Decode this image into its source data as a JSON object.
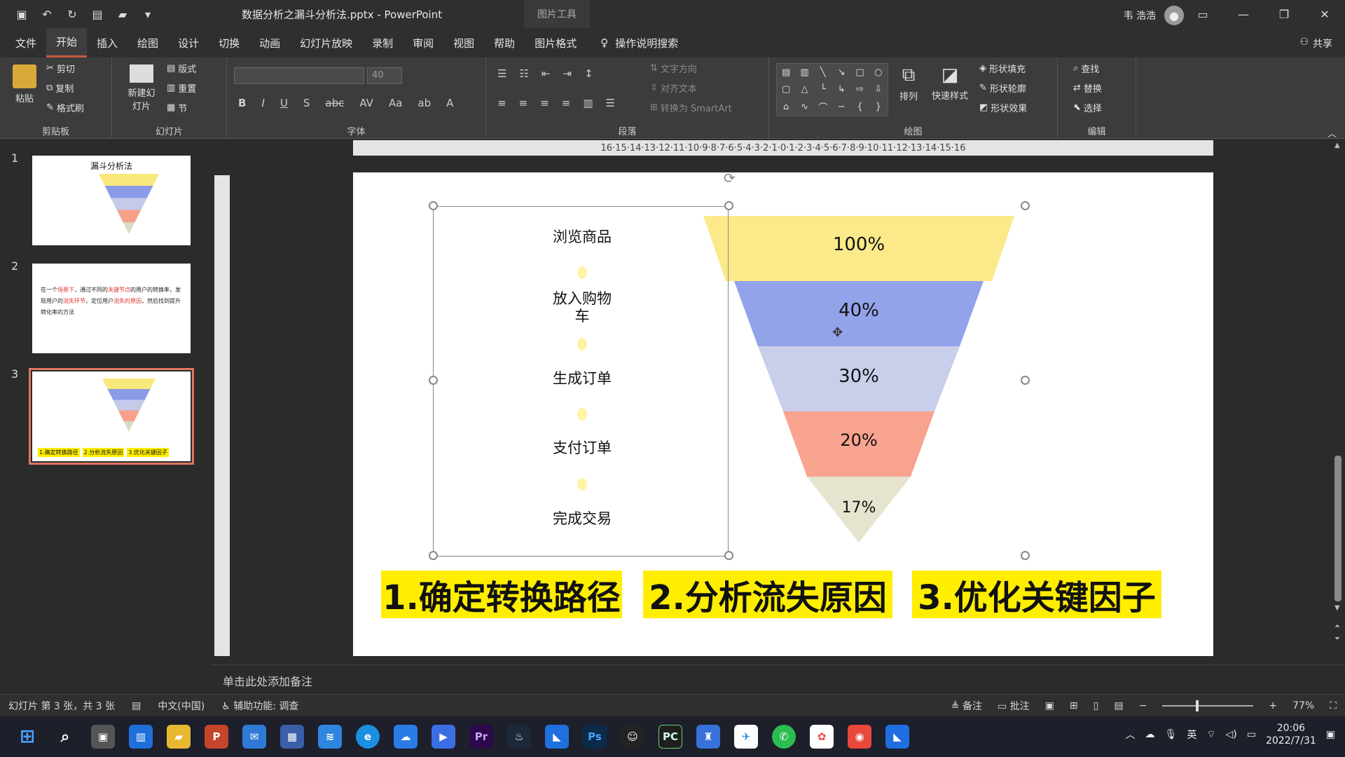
{
  "titlebar": {
    "doc_title": "数据分析之漏斗分析法.pptx - PowerPoint",
    "contextual_tab": "图片工具",
    "user_name": "韦 浩浩"
  },
  "menu": {
    "tabs": [
      "文件",
      "开始",
      "插入",
      "绘图",
      "设计",
      "切换",
      "动画",
      "幻灯片放映",
      "录制",
      "审阅",
      "视图",
      "帮助",
      "图片格式"
    ],
    "active_tab": "开始",
    "search_label": "操作说明搜索",
    "share_label": "共享"
  },
  "ribbon": {
    "clipboard": {
      "paste": "粘贴",
      "cut": "剪切",
      "copy": "复制",
      "format_painter": "格式刷",
      "label": "剪贴板"
    },
    "slides": {
      "new_slide": "新建幻灯片",
      "layout": "版式",
      "reset": "重置",
      "section": "节",
      "label": "幻灯片"
    },
    "font": {
      "size": "40",
      "label": "字体"
    },
    "paragraph": {
      "text_direction": "文字方向",
      "align_text": "对齐文本",
      "smartart": "转换为 SmartArt",
      "label": "段落"
    },
    "drawing": {
      "arrange": "排列",
      "quick_styles": "快速样式",
      "shape_fill": "形状填充",
      "shape_outline": "形状轮廓",
      "shape_effects": "形状效果",
      "label": "绘图"
    },
    "editing": {
      "find": "查找",
      "replace": "替换",
      "select": "选择",
      "label": "编辑"
    }
  },
  "thumbnails": {
    "slide1_title": "漏斗分析法",
    "slide2_text_parts": [
      "在一个",
      "场景下",
      "，通过不同的",
      "关键节点",
      "的用户的转换率，发现用户的",
      "流失环节",
      "，定位用户",
      "流失的原因",
      "，然后找到提升转化率的方法"
    ],
    "slide3_bars": [
      "1.确定转换路径",
      "2.分析流失原因",
      "3.优化关键因子"
    ],
    "numbers": [
      "1",
      "2",
      "3"
    ]
  },
  "slide": {
    "steps": [
      "浏览商品",
      "放入购物\n车",
      "生成订单",
      "支付订单",
      "完成交易"
    ],
    "percentages": [
      "100%",
      "40%",
      "30%",
      "20%",
      "17%"
    ],
    "banners": [
      "1.确定转换路径",
      "2.分析流失原因",
      "3.优化关键因子"
    ],
    "funnel_colors": [
      "#fbe98a",
      "#93a3ea",
      "#c9ceea",
      "#f8a38f",
      "#e6e3cf"
    ]
  },
  "notes_placeholder": "单击此处添加备注",
  "status": {
    "slide_info": "幻灯片 第 3 张，共 3 张",
    "language": "中文(中国)",
    "accessibility": "辅助功能: 调查",
    "notes": "备注",
    "comments": "批注",
    "zoom": "77%"
  },
  "taskbar": {
    "time": "20:06",
    "date": "2022/7/31",
    "ime": "英"
  }
}
